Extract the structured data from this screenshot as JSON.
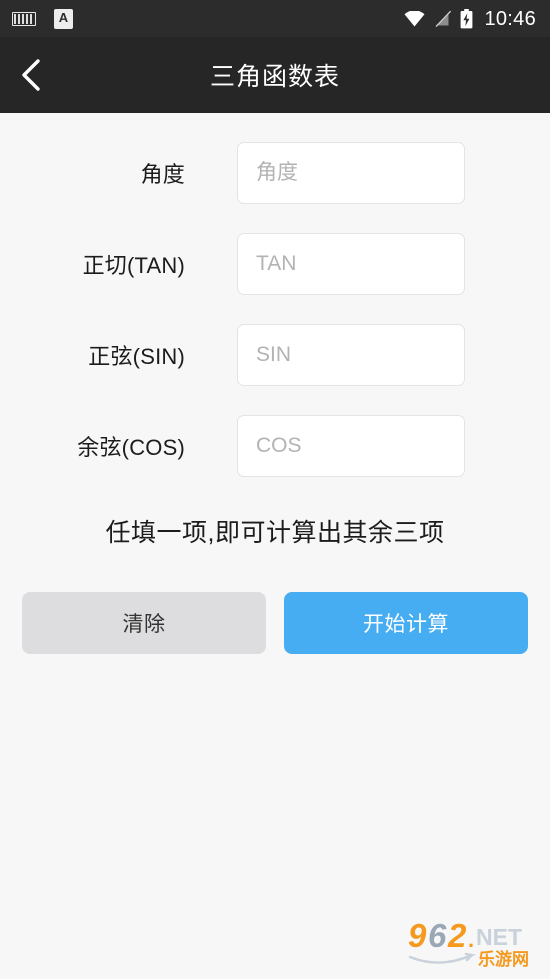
{
  "status_bar": {
    "icons_left": [
      "keyboard-icon",
      "ime-a-icon"
    ],
    "ime_letter": "A",
    "icons_right": [
      "wifi-icon",
      "no-sim-icon",
      "battery-charging-icon"
    ],
    "time": "10:46"
  },
  "header": {
    "back_icon": "chevron-left-icon",
    "title": "三角函数表"
  },
  "form": {
    "fields": [
      {
        "label": "角度",
        "placeholder": "角度",
        "value": ""
      },
      {
        "label": "正切(TAN)",
        "placeholder": "TAN",
        "value": ""
      },
      {
        "label": "正弦(SIN)",
        "placeholder": "SIN",
        "value": ""
      },
      {
        "label": "余弦(COS)",
        "placeholder": "COS",
        "value": ""
      }
    ],
    "hint": "任填一项,即可计算出其余三项"
  },
  "buttons": {
    "clear_label": "清除",
    "calculate_label": "开始计算"
  },
  "watermark": {
    "digits": "962",
    "suffix": ".NET",
    "chinese": "乐游网"
  },
  "colors": {
    "status_bar_bg": "#2c2c2c",
    "header_bg": "#262626",
    "page_bg": "#f7f7f8",
    "accent_blue": "#47adf2",
    "clear_gray": "#dddddf",
    "input_border": "#e4e4e6",
    "placeholder": "#b3b3b6"
  }
}
